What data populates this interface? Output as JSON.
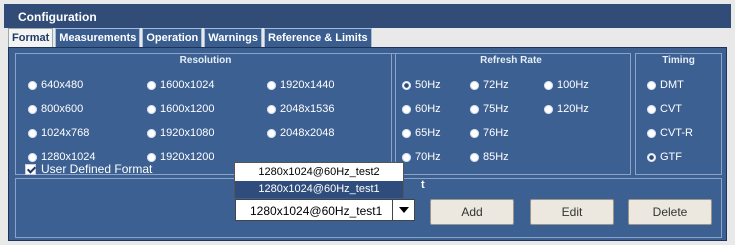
{
  "window": {
    "title": "Configuration"
  },
  "tabs": [
    "Format",
    "Measurements",
    "Operation",
    "Warnings",
    "Reference & Limits"
  ],
  "resolution": {
    "title": "Resolution",
    "options": [
      "640x480",
      "800x600",
      "1024x768",
      "1280x1024",
      "1600x1024",
      "1600x1200",
      "1920x1080",
      "1920x1200",
      "1920x1440",
      "2048x1536",
      "2048x2048"
    ]
  },
  "refresh_rate": {
    "title": "Refresh Rate",
    "options": [
      "50Hz",
      "60Hz",
      "65Hz",
      "70Hz",
      "72Hz",
      "75Hz",
      "76Hz",
      "85Hz",
      "100Hz",
      "120Hz"
    ],
    "selected": "50Hz"
  },
  "timing": {
    "title": "Timing",
    "options": [
      "DMT",
      "CVT",
      "CVT-R",
      "GTF"
    ],
    "selected": "GTF"
  },
  "user_defined": {
    "checkbox_label": "User Defined Format",
    "checked": true,
    "dropdown_items": [
      "1280x1024@60Hz_test2",
      "1280x1024@60Hz_test1"
    ],
    "selected_value": "1280x1024@60Hz_test1",
    "label_fragment": "t"
  },
  "buttons": {
    "add": "Add",
    "edit": "Edit",
    "delete": "Delete"
  }
}
